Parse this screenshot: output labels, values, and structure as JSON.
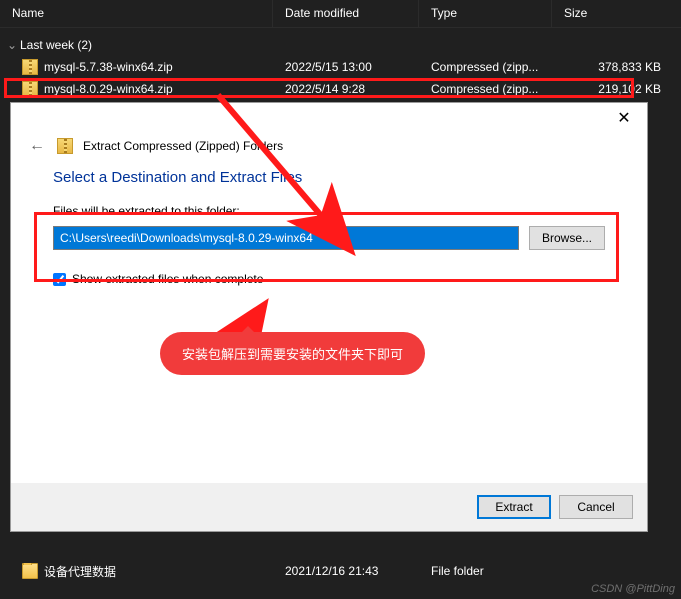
{
  "columns": {
    "name": "Name",
    "date": "Date modified",
    "type": "Type",
    "size": "Size"
  },
  "group": {
    "label": "Last week (2)"
  },
  "files": [
    {
      "name": "mysql-5.7.38-winx64.zip",
      "date": "2022/5/15 13:00",
      "type": "Compressed (zipp...",
      "size": "378,833 KB"
    },
    {
      "name": "mysql-8.0.29-winx64.zip",
      "date": "2022/5/14 9:28",
      "type": "Compressed (zipp...",
      "size": "219,102 KB"
    }
  ],
  "bottom_folder": {
    "name": "设备代理数据",
    "date": "2021/12/16 21:43",
    "type": "File folder",
    "size": ""
  },
  "dialog": {
    "title": "Extract Compressed (Zipped) Folders",
    "heading": "Select a Destination and Extract Files",
    "label": "Files will be extracted to this folder:",
    "path": "C:\\Users\\reedi\\Downloads\\mysql-8.0.29-winx64",
    "browse": "Browse...",
    "show_label": "Show extracted files when complete",
    "extract": "Extract",
    "cancel": "Cancel"
  },
  "annotation": {
    "bubble_text": "安装包解压到需要安装的文件夹下即可"
  },
  "watermark": "CSDN @PittDing"
}
